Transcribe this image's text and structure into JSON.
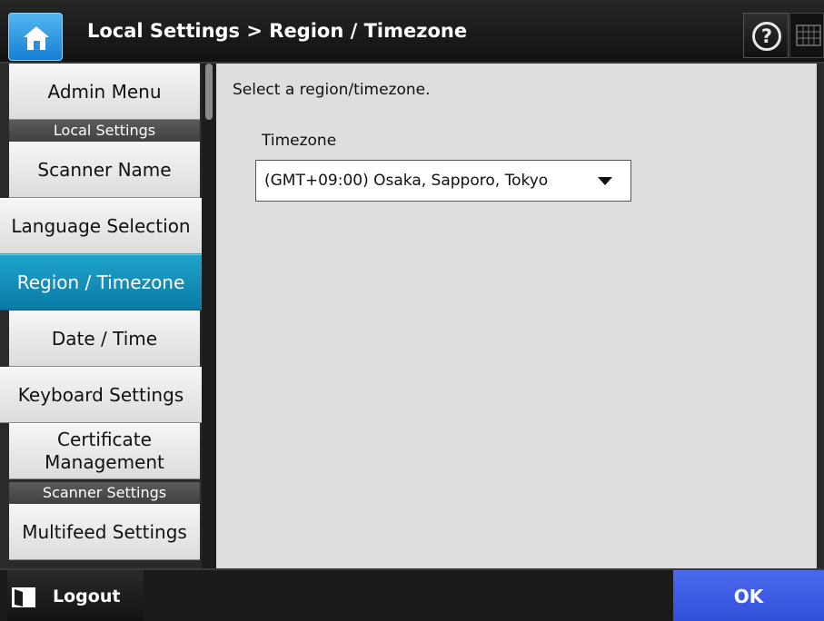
{
  "header": {
    "title": "Local Settings > Region / Timezone",
    "help_glyph": "?",
    "icons": {
      "home": "home-icon",
      "help": "help-icon",
      "keyboard": "keyboard-icon"
    }
  },
  "sidebar": {
    "items": [
      {
        "label": "Admin Menu",
        "type": "button"
      },
      {
        "label": "Local Settings",
        "type": "header"
      },
      {
        "label": "Scanner Name",
        "type": "button"
      },
      {
        "label": "Language Selection",
        "type": "button"
      },
      {
        "label": "Region / Timezone",
        "type": "button",
        "active": true
      },
      {
        "label": "Date / Time",
        "type": "button"
      },
      {
        "label": "Keyboard Settings",
        "type": "button"
      },
      {
        "label": "Certificate Management",
        "type": "button"
      },
      {
        "label": "Scanner Settings",
        "type": "header"
      },
      {
        "label": "Multifeed Settings",
        "type": "button"
      }
    ]
  },
  "main": {
    "instruction": "Select a region/timezone.",
    "timezone_label": "Timezone",
    "timezone_value": "(GMT+09:00) Osaka, Sapporo, Tokyo"
  },
  "footer": {
    "logout_label": "Logout",
    "ok_label": "OK"
  },
  "colors": {
    "active_nav": "#0a7aa6",
    "ok_button": "#3a5ae0",
    "home_button": "#2b98e4"
  }
}
